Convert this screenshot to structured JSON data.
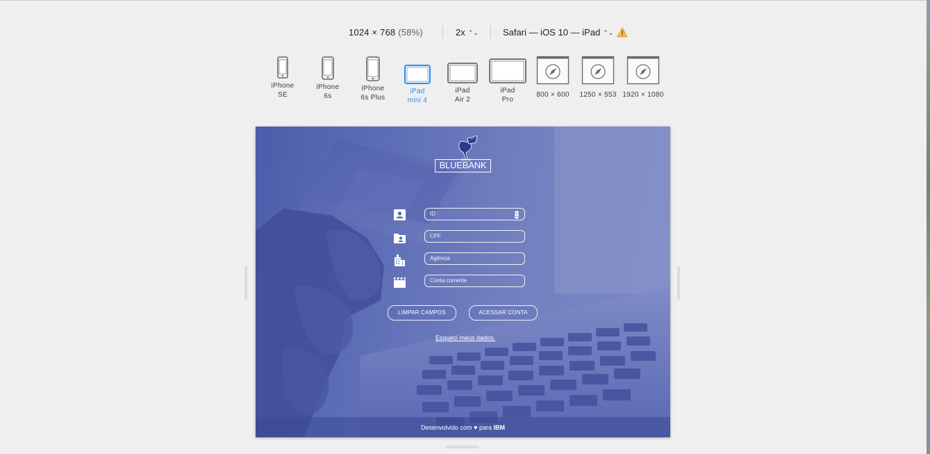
{
  "toolbar": {
    "resolution": "1024 × 768",
    "zoom": "(58%)",
    "scale": "2x",
    "user_agent": "Safari — iOS 10 — iPad",
    "warning_icon": "warning-triangle-icon"
  },
  "devices": [
    {
      "line1": "iPhone",
      "line2": "SE",
      "icon": "phone-icon",
      "active": false
    },
    {
      "line1": "iPhone",
      "line2": "6s",
      "icon": "phone-icon",
      "active": false
    },
    {
      "line1": "iPhone",
      "line2": "6s Plus",
      "icon": "phone-icon",
      "active": false
    },
    {
      "line1": "iPad",
      "line2": "mini 4",
      "icon": "tablet-icon",
      "active": true
    },
    {
      "line1": "iPad",
      "line2": "Air 2",
      "icon": "tablet-icon",
      "active": false
    },
    {
      "line1": "iPad",
      "line2": "Pro",
      "icon": "tablet-icon",
      "active": false
    },
    {
      "line1": "800 × 600",
      "line2": "",
      "icon": "compass-icon",
      "active": false
    },
    {
      "line1": "1250 × 553",
      "line2": "",
      "icon": "compass-icon",
      "active": false
    },
    {
      "line1": "1920 × 1080",
      "line2": "",
      "icon": "compass-icon",
      "active": false
    }
  ],
  "app": {
    "logo_text": "BLUEBANK",
    "fields": [
      {
        "placeholder": "ID",
        "icon": "contact-card-icon"
      },
      {
        "placeholder": "CPF",
        "icon": "folder-user-icon"
      },
      {
        "placeholder": "Agência",
        "icon": "building-icon"
      },
      {
        "placeholder": "Conta corrente",
        "icon": "clapperboard-icon"
      }
    ],
    "clear_button": "LIMPAR CAMPOS",
    "access_button": "ACESSAR CONTA",
    "forgot_link": "Esqueci meus dados.",
    "footer_prefix": "Desenvolvido com",
    "footer_for": "para",
    "footer_brand": "IBM"
  },
  "colors": {
    "accent": "#2d8ef0",
    "overlay": "#5262b0",
    "background": "#efefef"
  }
}
